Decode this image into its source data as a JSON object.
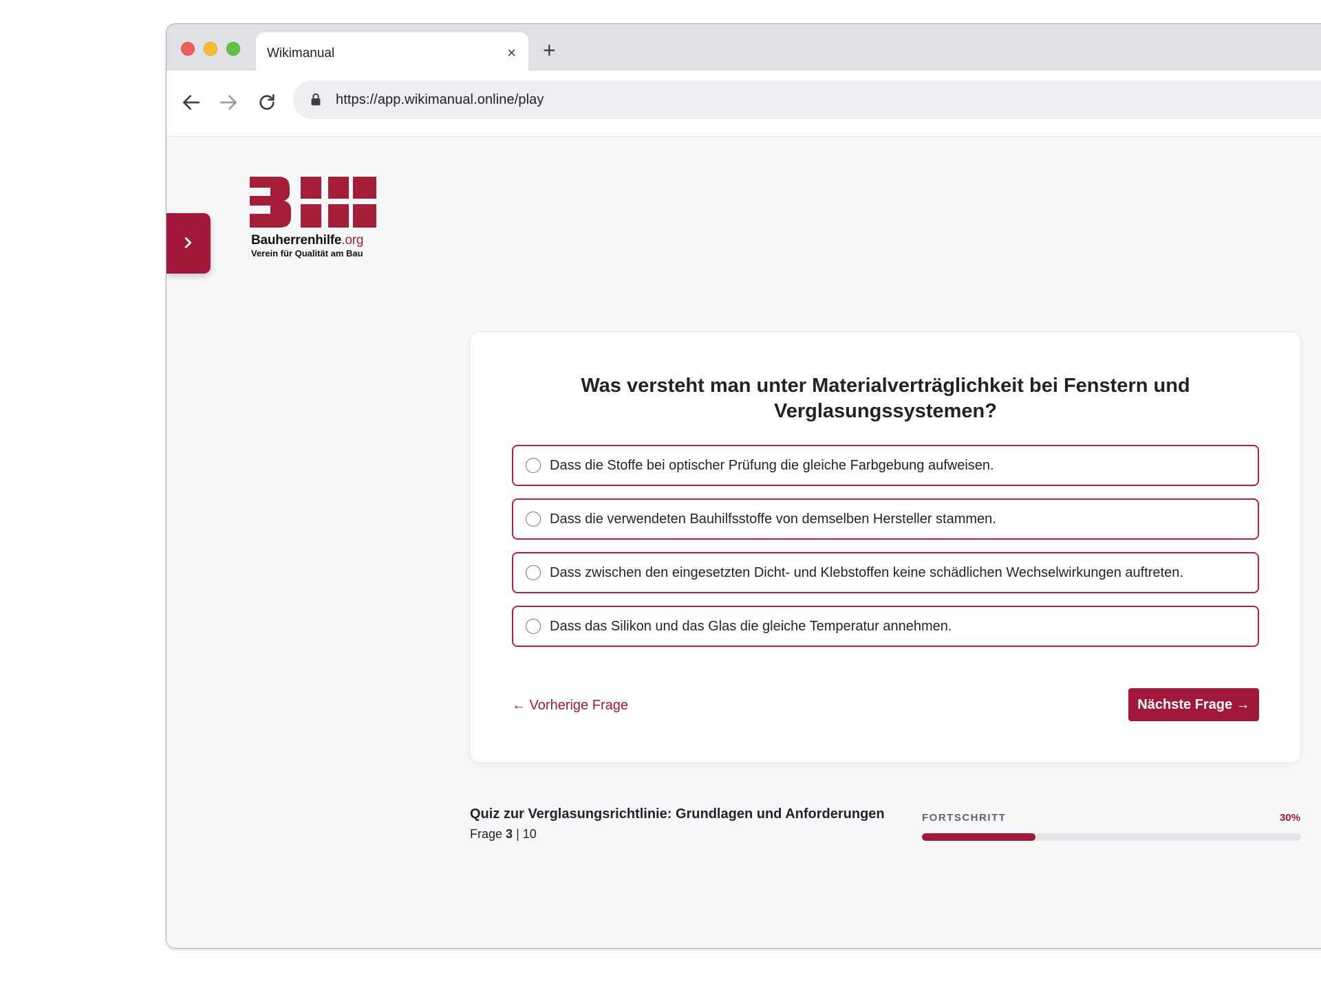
{
  "browser": {
    "tab_title": "Wikimanual",
    "tab_close_symbol": "×",
    "new_tab_symbol": "+",
    "url": "https://app.wikimanual.online/play"
  },
  "logo": {
    "name_main": "Bauherrenhilfe",
    "name_suffix": ".org",
    "tagline": "Verein für Qualität am Bau",
    "letters": "BHH",
    "color": "#a51e38"
  },
  "quiz": {
    "question": "Was versteht man unter Materialverträglichkeit bei Fenstern und Verglasungssystemen?",
    "options": [
      {
        "label": "Dass die Stoffe bei optischer Prüfung die gleiche Farbgebung aufweisen."
      },
      {
        "label": "Dass die verwendeten Bauhilfsstoffe von demselben Hersteller stammen."
      },
      {
        "label": "Dass zwischen den eingesetzten Dicht- und Klebstoffen keine schädlichen Wechselwirkungen auftreten."
      },
      {
        "label": "Dass das Silikon und das Glas die gleiche Temperatur annehmen."
      }
    ],
    "prev_label": "← Vorherige Frage",
    "next_label": "Nächste Frage →",
    "title": "Quiz zur Verglasungsrichtlinie: Grundlagen und Anforderungen",
    "frage_label": "Frage",
    "current_question": "3",
    "separator": "|",
    "total_questions": "10",
    "progress_label": "FORTSCHRITT",
    "progress_text": "30%",
    "progress_fraction": 0.3
  },
  "colors": {
    "accent": "#a1183a",
    "option_border": "#b3213f"
  },
  "icons": {
    "back": "arrow-left-icon",
    "forward": "arrow-right-icon",
    "reload": "reload-icon",
    "lock": "lock-icon",
    "sidebar_toggle": "chevron-right-icon"
  }
}
